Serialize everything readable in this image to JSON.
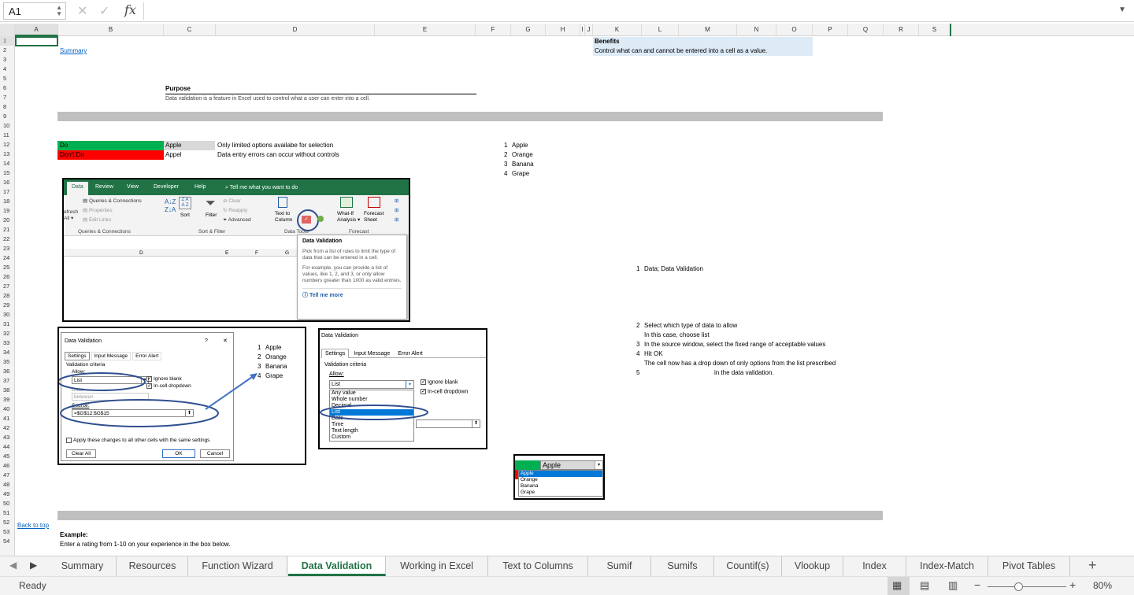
{
  "formula_bar": {
    "name_box": "A1",
    "fx_label": "fx",
    "formula": ""
  },
  "columns": [
    "A",
    "B",
    "C",
    "D",
    "E",
    "F",
    "G",
    "H",
    "I",
    "J",
    "K",
    "L",
    "M",
    "N",
    "O",
    "P",
    "Q",
    "R",
    "S"
  ],
  "rows": [
    "1",
    "2",
    "3",
    "4",
    "5",
    "6",
    "7",
    "8",
    "9",
    "10",
    "11",
    "12",
    "13",
    "14",
    "15",
    "16",
    "17",
    "18",
    "19",
    "20",
    "21",
    "22",
    "23",
    "24",
    "25",
    "26",
    "27",
    "28",
    "29",
    "30",
    "31",
    "32",
    "33",
    "34",
    "35",
    "36",
    "37",
    "38",
    "39",
    "40",
    "41",
    "42",
    "43",
    "44",
    "45",
    "46",
    "47",
    "48",
    "49",
    "50",
    "51",
    "52",
    "53",
    "54"
  ],
  "cells": {
    "summary_link": "Summary",
    "benefits_title": "Benefits",
    "benefits_text": "Control what can and cannot be entered into a cell as a value.",
    "purpose_title": "Purpose",
    "purpose_text": "Data validation is a feature in Excel used to control what a user can enter into a cell.",
    "do_label": "Do",
    "dont_label": "Don't Do",
    "do_value": "Apple",
    "dont_value": "Appel",
    "do_note": "Only limited options availabe for selection",
    "dont_note": "Data entry errors can occur without controls",
    "list": [
      {
        "n": "1",
        "v": "Apple"
      },
      {
        "n": "2",
        "v": "Orange"
      },
      {
        "n": "3",
        "v": "Banana"
      },
      {
        "n": "4",
        "v": "Grape"
      }
    ],
    "steps": [
      {
        "n": "1",
        "t": "Data; Data Validation"
      },
      {
        "n": "2",
        "t": "Select which type of data to allow"
      },
      {
        "n": "",
        "t": "In this case, choose list"
      },
      {
        "n": "3",
        "t": "In the source window, select the fixed range of acceptable values"
      },
      {
        "n": "4",
        "t": "Hit OK"
      },
      {
        "n": "",
        "t": "The cell now has a drop down of only options from the list prescribed"
      },
      {
        "n": "5",
        "t": "in the data validation."
      }
    ],
    "back_to_top": "Back to top",
    "example_title": "Example:",
    "example_text": "Enter a rating from 1-10 on your experience in the box below."
  },
  "ribbon_shot": {
    "tabs": [
      "Data",
      "Review",
      "View",
      "Developer",
      "Help"
    ],
    "tell_me": "Tell me what you want to do",
    "group1": [
      "Queries & Connections",
      "Properties",
      "Edit Links"
    ],
    "refresh": "efresh",
    "refresh2": "All",
    "group1_label": "Queries & Connections",
    "sort": "Sort",
    "filter": "Filter",
    "clear": "Clear",
    "reapply": "Reapply",
    "advanced": "Advanced",
    "sort_filter_label": "Sort & Filter",
    "text_to": "Text to",
    "columns": "Column",
    "data_tools": "Data Tools",
    "whatif": "What-If",
    "analysis": "Analysis",
    "forecast": "Forecast",
    "sheet": "Sheet",
    "forecast_label": "Forecast",
    "col_d": "D",
    "col_e": "E",
    "col_f": "F",
    "col_g": "G",
    "tip_title": "Data Validation",
    "tip_body1": "Pick from a list of rules to limit the type of data that can be entered in a cell.",
    "tip_body2": "For example, you can provide a list of values, like 1, 2, and 3, or only allow numbers greater than 1000 as valid entries.",
    "tip_more": "Tell me more"
  },
  "dialog1": {
    "title": "Data Validation",
    "help": "?",
    "close": "✕",
    "tabs": [
      "Settings",
      "Input Message",
      "Error Alert"
    ],
    "criteria": "Validation criteria",
    "allow": "Allow:",
    "allow_value": "List",
    "data": "Data:",
    "data_value": "between",
    "ignore_blank": "Ignore blank",
    "in_cell": "In-cell dropdown",
    "source": "Source:",
    "source_value": "=$G$12:$G$15",
    "apply_all": "Apply these changes to all other cells with the same settings",
    "clear_all": "Clear All",
    "ok": "OK",
    "cancel": "Cancel",
    "list": [
      {
        "n": "1",
        "v": "Apple"
      },
      {
        "n": "2",
        "v": "Orange"
      },
      {
        "n": "3",
        "v": "Banana"
      },
      {
        "n": "4",
        "v": "Grape"
      }
    ]
  },
  "dialog2": {
    "title": "Data Validation",
    "tabs": [
      "Settings",
      "Input Message",
      "Error Alert"
    ],
    "criteria": "Validation criteria",
    "allow": "Allow:",
    "allow_value": "List",
    "ignore_blank": "Ignore blank",
    "in_cell": "In-cell dropdown",
    "options": [
      "Any value",
      "Whole number",
      "Decimal",
      "List",
      "Date",
      "Time",
      "Text length",
      "Custom"
    ],
    "selected": "List"
  },
  "dropdown_shot": {
    "value": "Apple",
    "options": [
      "Apple",
      "Orange",
      "Banana",
      "Grape"
    ]
  },
  "sheet_tabs": [
    "Summary",
    "Resources",
    "Function Wizard",
    "Data Validation",
    "Working in Excel",
    "Text to Columns",
    "Sumif",
    "Sumifs",
    "Countif(s)",
    "Vlookup",
    "Index",
    "Index-Match",
    "Pivot Tables"
  ],
  "active_tab": "Data Validation",
  "status": {
    "ready": "Ready",
    "zoom": "80%",
    "add": "+"
  },
  "colors": {
    "excel_green": "#217346",
    "do_green": "#00b050",
    "dont_red": "#ff0000",
    "band_grey": "#bfbfbf",
    "benefit_blue": "#ddebf7"
  }
}
